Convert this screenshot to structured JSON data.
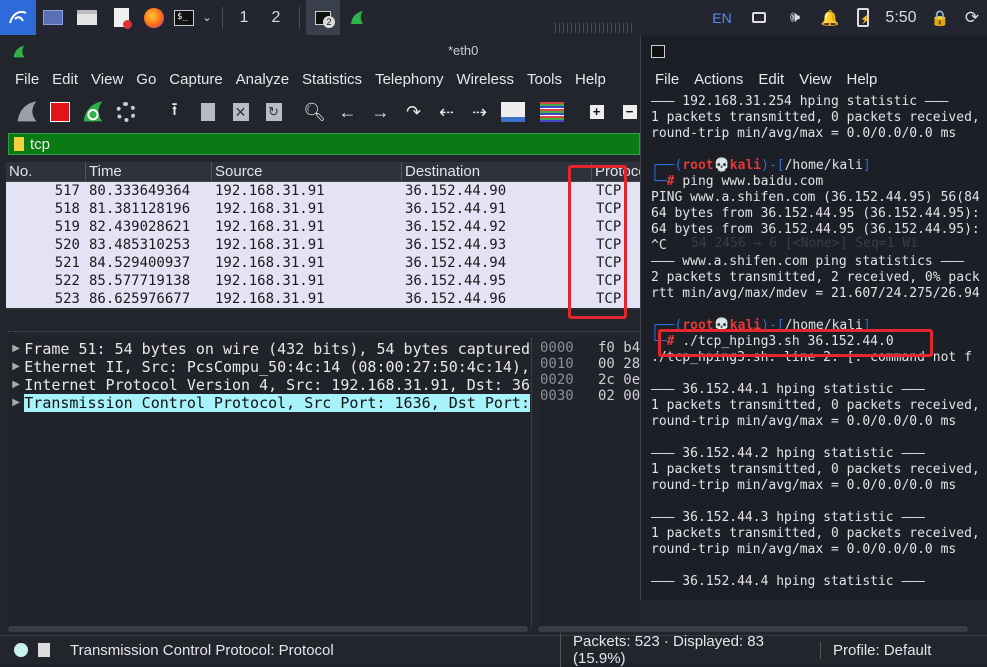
{
  "taskbar": {
    "workspaces": [
      "1",
      "2"
    ],
    "terminal_badge": "2",
    "keyboard_layout": "EN",
    "clock": "5:50"
  },
  "wireshark": {
    "title": "*eth0",
    "menu": [
      "File",
      "Edit",
      "View",
      "Go",
      "Capture",
      "Analyze",
      "Statistics",
      "Telephony",
      "Wireless",
      "Tools",
      "Help"
    ],
    "filter_value": "tcp",
    "columns": [
      "No.",
      "Time",
      "Source",
      "Destination",
      "Protoco"
    ],
    "packets": [
      {
        "no": "517",
        "time": "80.333649364",
        "src": "192.168.31.91",
        "dst": "36.152.44.90",
        "proto": "TCP"
      },
      {
        "no": "518",
        "time": "81.381128196",
        "src": "192.168.31.91",
        "dst": "36.152.44.91",
        "proto": "TCP"
      },
      {
        "no": "519",
        "time": "82.439028621",
        "src": "192.168.31.91",
        "dst": "36.152.44.92",
        "proto": "TCP"
      },
      {
        "no": "520",
        "time": "83.485310253",
        "src": "192.168.31.91",
        "dst": "36.152.44.93",
        "proto": "TCP"
      },
      {
        "no": "521",
        "time": "84.529400937",
        "src": "192.168.31.91",
        "dst": "36.152.44.94",
        "proto": "TCP"
      },
      {
        "no": "522",
        "time": "85.577719138",
        "src": "192.168.31.91",
        "dst": "36.152.44.95",
        "proto": "TCP"
      },
      {
        "no": "523",
        "time": "86.625976677",
        "src": "192.168.31.91",
        "dst": "36.152.44.96",
        "proto": "TCP"
      }
    ],
    "details": [
      "Frame 51: 54 bytes on wire (432 bits), 54 bytes captured",
      "Ethernet II, Src: PcsCompu_50:4c:14 (08:00:27:50:4c:14),",
      "Internet Protocol Version 4, Src: 192.168.31.91, Dst: 36",
      "Transmission Control Protocol, Src Port: 1636, Dst Port:"
    ],
    "hex": [
      {
        "off": "0000",
        "bytes": "f0 b4"
      },
      {
        "off": "0010",
        "bytes": "00 28"
      },
      {
        "off": "0020",
        "bytes": "2c 0e"
      },
      {
        "off": "0030",
        "bytes": "02 00"
      }
    ],
    "status": {
      "field": "Transmission Control Protocol: Protocol",
      "packets": "Packets: 523 · Displayed: 83 (15.9%)",
      "profile": "Profile: Default"
    }
  },
  "terminal": {
    "menu": [
      "File",
      "Actions",
      "Edit",
      "View",
      "Help"
    ],
    "lines": [
      "——— 192.168.31.254 hping statistic ———",
      "1 packets transmitted, 0 packets received,",
      "round-trip min/avg/max = 0.0/0.0/0.0 ms",
      "",
      "PROMPT1",
      "CMD1",
      "PING www.a.shifen.com (36.152.44.95) 56(84",
      "64 bytes from 36.152.44.95 (36.152.44.95):",
      "64 bytes from 36.152.44.95 (36.152.44.95):",
      "^C",
      "——— www.a.shifen.com ping statistics ———",
      "2 packets transmitted, 2 received, 0% pack",
      "rtt min/avg/max/mdev = 21.607/24.275/26.94",
      "",
      "PROMPT2",
      "CMD2",
      "./tcp_hping3.sh: line 2: [: command not f",
      "",
      "——— 36.152.44.1 hping statistic ———",
      "1 packets transmitted, 0 packets received,",
      "round-trip min/avg/max = 0.0/0.0/0.0 ms",
      "",
      "——— 36.152.44.2 hping statistic ———",
      "1 packets transmitted, 0 packets received,",
      "round-trip min/avg/max = 0.0/0.0/0.0 ms",
      "",
      "——— 36.152.44.3 hping statistic ———",
      "1 packets transmitted, 0 packets received,",
      "round-trip min/avg/max = 0.0/0.0/0.0 ms",
      "",
      "——— 36.152.44.4 hping statistic ———"
    ],
    "prompt_user": "root",
    "prompt_host": "kali",
    "prompt_dir": "/home/kali",
    "cmd1": "ping www.baidu.com",
    "cmd2_script": "./tcp_hping3.sh",
    "cmd2_arg": "36.152.44.0",
    "ghost_text": "54 2456 → 6 [<None>] Seq=1 Wi"
  }
}
